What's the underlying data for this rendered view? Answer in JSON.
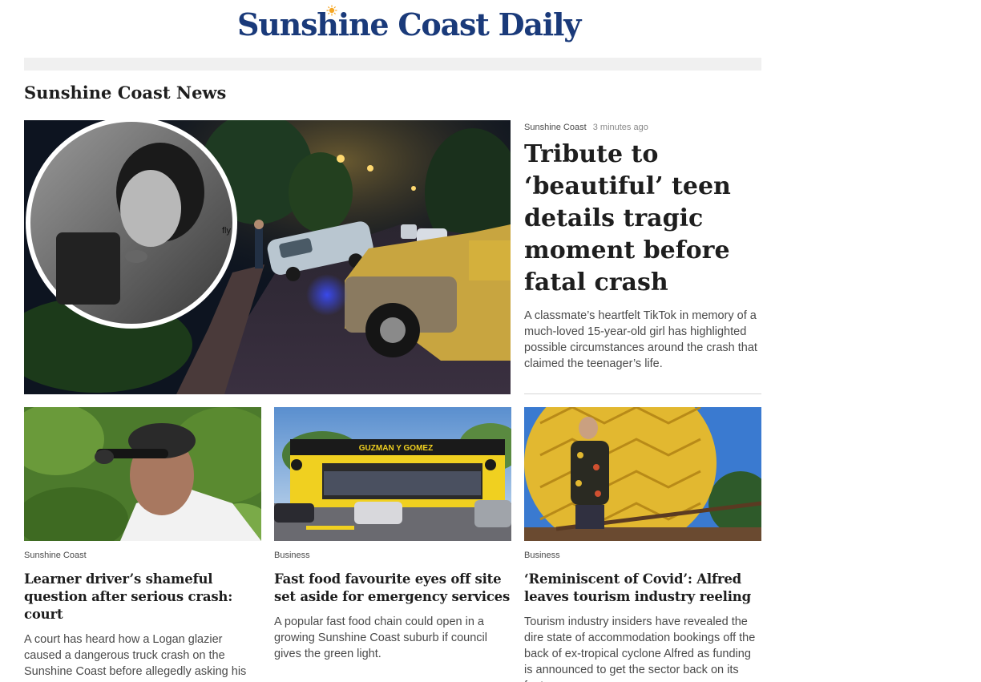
{
  "site": {
    "title": "Sunshine Coast Daily"
  },
  "section": {
    "title": "Sunshine Coast News"
  },
  "hero": {
    "category": "Sunshine Coast",
    "time": "3 minutes ago",
    "title": "Tribute to ‘beautiful’ teen details tragic moment before fatal crash",
    "description": "A classmate’s heartfelt TikTok in memory of a much-loved 15-year-old girl has highlighted possible circumstances around the crash that claimed the teenager’s life.",
    "image_overlay_text": "fly"
  },
  "cards": [
    {
      "category": "Sunshine Coast",
      "title": "Learner driver’s shameful question after serious crash: court",
      "description": "A court has heard how a Logan glazier caused a dangerous truck crash on the Sunshine Coast before allegedly asking his maimed traveller to take the blame."
    },
    {
      "category": "Business",
      "title": "Fast food favourite eyes off site set aside for emergency services",
      "description": "A popular fast food chain could open in a growing Sunshine Coast suburb if council gives the green light.",
      "image_sign_text": "GUZMAN Y GOMEZ"
    },
    {
      "category": "Business",
      "title": "‘Reminiscent of Covid’: Alfred leaves tourism industry reeling",
      "description": "Tourism industry insiders have revealed the dire state of accommodation bookings off the back of ex-tropical cyclone Alfred as funding is announced to get the sector back on its feet."
    }
  ],
  "colors": {
    "brand": "#1a3a7a",
    "accent_sun": "#f5a623"
  }
}
